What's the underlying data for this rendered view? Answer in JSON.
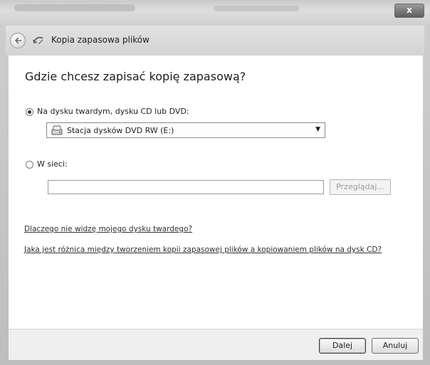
{
  "window": {
    "close_label": "x"
  },
  "nav": {
    "title": "Kopia zapasowa plików"
  },
  "main": {
    "heading": "Gdzie chcesz zapisać kopię zapasową?",
    "option_disk": {
      "label": "Na dysku twardym, dysku CD lub DVD:",
      "selected": true
    },
    "drive_select": {
      "value": "Stacja dysków DVD RW (E:)"
    },
    "option_network": {
      "label": "W sieci:",
      "selected": false
    },
    "network_path": {
      "value": "",
      "placeholder": ""
    },
    "browse_label": "Przeglądaj...",
    "link_why": "Dlaczego nie widzę mojego dysku twardego?",
    "link_difference": "Jaka jest różnica między tworzeniem kopii zapasowej plików a kopiowaniem plików na dysk CD?"
  },
  "footer": {
    "next_label": "Dalej",
    "cancel_label": "Anuluj"
  }
}
